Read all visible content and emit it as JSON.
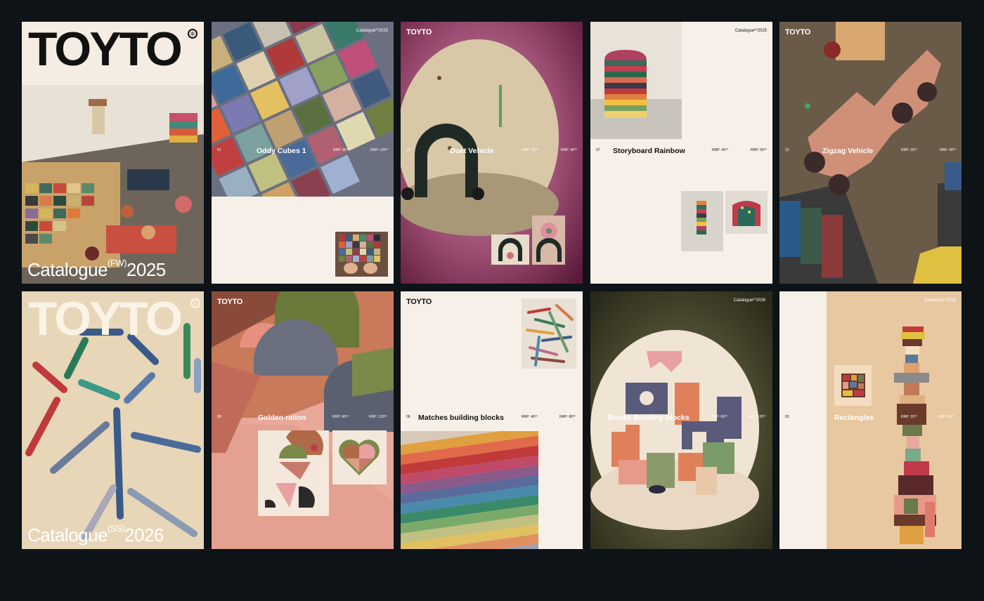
{
  "brand": "TOYTO",
  "reg_mark": "®",
  "cards": {
    "c1": {
      "catalogue": "Catalogue",
      "season": "(FW)",
      "year": "2025"
    },
    "c2": {
      "num": "01",
      "title": "Oddy Cubes 1",
      "rrp1": "RRP: 60⁰⁰",
      "rrp2": "RRP: 120⁰⁰",
      "corner": "Catalogue²⁰2025"
    },
    "c3": {
      "num": "10",
      "title": "Duet Vehicle",
      "rrp1": "RRP: 25⁰⁰",
      "rrp2": "RRP: 40⁰⁰"
    },
    "c4": {
      "num": "07",
      "title": "Storyboard Rainbow",
      "rrp1": "RRP: 40⁰⁰",
      "rrp2": "RRP: 60⁰⁰",
      "corner": "Catalogue²⁰2025"
    },
    "c5": {
      "num": "12",
      "title": "Zigzag Vehicle",
      "rrp1": "RRP: 25⁰⁰",
      "rrp2": "RRP: 40⁰⁰"
    },
    "c6": {
      "catalogue": "Catalogue",
      "season": "(SS)",
      "year": "2026"
    },
    "c7": {
      "num": "08",
      "title": "Golden ration",
      "rrp1": "RRP: 60⁰⁰",
      "rrp2": "RRP: 120⁰⁰"
    },
    "c8": {
      "num": "06",
      "title": "Matches building blocks",
      "rrp1": "RRP: 40⁰⁰",
      "rrp2": "RRP: 80⁰⁰"
    },
    "c9": {
      "num": "11",
      "title": "Blocks Building Blocks",
      "rrp1": "RRP: 60⁰⁰",
      "rrp2": "RRP: 120⁰⁰",
      "corner": "Catalogue²⁰2026"
    },
    "c10": {
      "num": "03",
      "title": "Rectangles",
      "rrp1": "RRP: 32⁰⁰",
      "rrp2": "RRP: 60⁰⁰",
      "corner": "Catalogue²⁰2026"
    }
  },
  "colors": {
    "background": "#0d1317",
    "cream": "#f7f0e8",
    "ink": "#111111"
  }
}
